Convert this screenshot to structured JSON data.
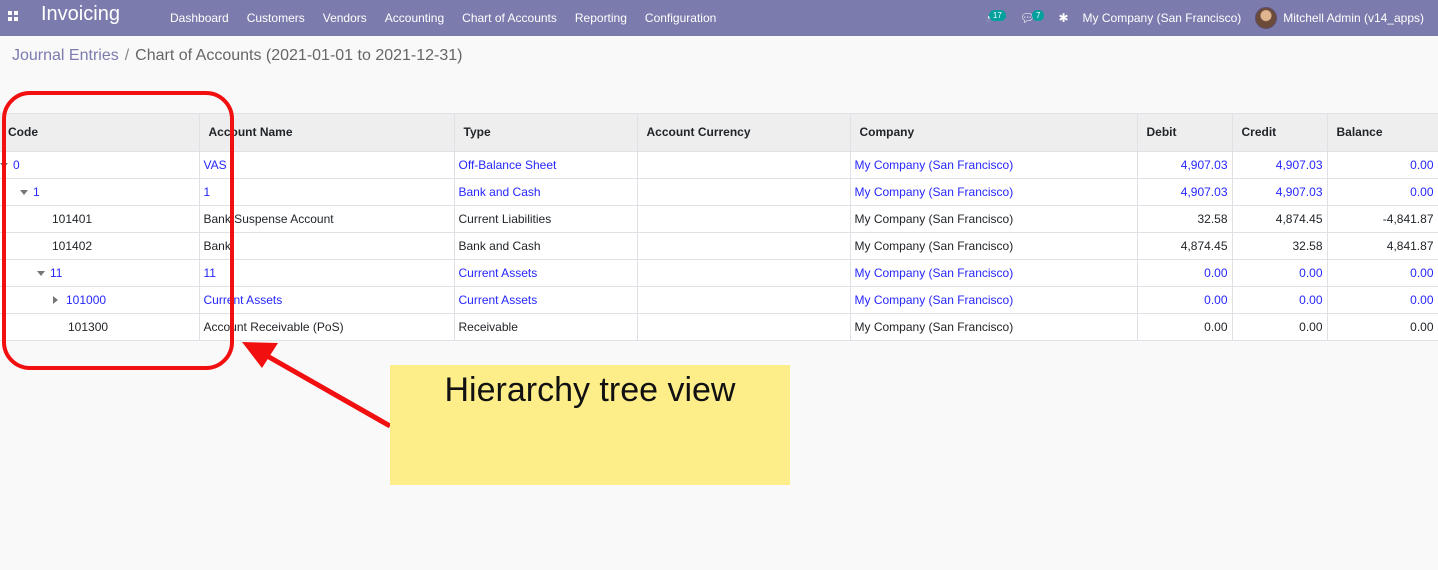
{
  "navbar": {
    "app_title": "Invoicing",
    "menu": [
      "Dashboard",
      "Customers",
      "Vendors",
      "Accounting",
      "Chart of Accounts",
      "Reporting",
      "Configuration"
    ],
    "activity_count": "17",
    "messages_count": "7",
    "company": "My Company (San Francisco)",
    "user": "Mitchell Admin (v14_apps)"
  },
  "breadcrumb": {
    "parent": "Journal Entries",
    "separator": "/",
    "current": "Chart of Accounts (2021-01-01 to 2021-12-31)"
  },
  "table": {
    "headers": [
      "Code",
      "Account Name",
      "Type",
      "Account Currency",
      "Company",
      "Debit",
      "Credit",
      "Balance"
    ],
    "rows": [
      {
        "code": "0",
        "name": "VAS",
        "type": "Off-Balance Sheet",
        "currency": "",
        "company": "My Company (San Francisco)",
        "debit": "4,907.03",
        "credit": "4,907.03",
        "balance": "0.00"
      },
      {
        "code": "1",
        "name": "1",
        "type": "Bank and Cash",
        "currency": "",
        "company": "My Company (San Francisco)",
        "debit": "4,907.03",
        "credit": "4,907.03",
        "balance": "0.00"
      },
      {
        "code": "101401",
        "name": "Bank Suspense Account",
        "type": "Current Liabilities",
        "currency": "",
        "company": "My Company (San Francisco)",
        "debit": "32.58",
        "credit": "4,874.45",
        "balance": "-4,841.87"
      },
      {
        "code": "101402",
        "name": "Bank",
        "type": "Bank and Cash",
        "currency": "",
        "company": "My Company (San Francisco)",
        "debit": "4,874.45",
        "credit": "32.58",
        "balance": "4,841.87"
      },
      {
        "code": "11",
        "name": "11",
        "type": "Current Assets",
        "currency": "",
        "company": "My Company (San Francisco)",
        "debit": "0.00",
        "credit": "0.00",
        "balance": "0.00"
      },
      {
        "code": "101000",
        "name": "Current Assets",
        "type": "Current Assets",
        "currency": "",
        "company": "My Company (San Francisco)",
        "debit": "0.00",
        "credit": "0.00",
        "balance": "0.00"
      },
      {
        "code": "101300",
        "name": "Account Receivable (PoS)",
        "type": "Receivable",
        "currency": "",
        "company": "My Company (San Francisco)",
        "debit": "0.00",
        "credit": "0.00",
        "balance": "0.00"
      }
    ]
  },
  "annotation": {
    "note_text": "Hierarchy tree view",
    "highlight_color": "#f20f0f",
    "note_color": "#fdee8a"
  },
  "colors": {
    "navbar": "#7c7bad",
    "link": "#2626ff"
  }
}
